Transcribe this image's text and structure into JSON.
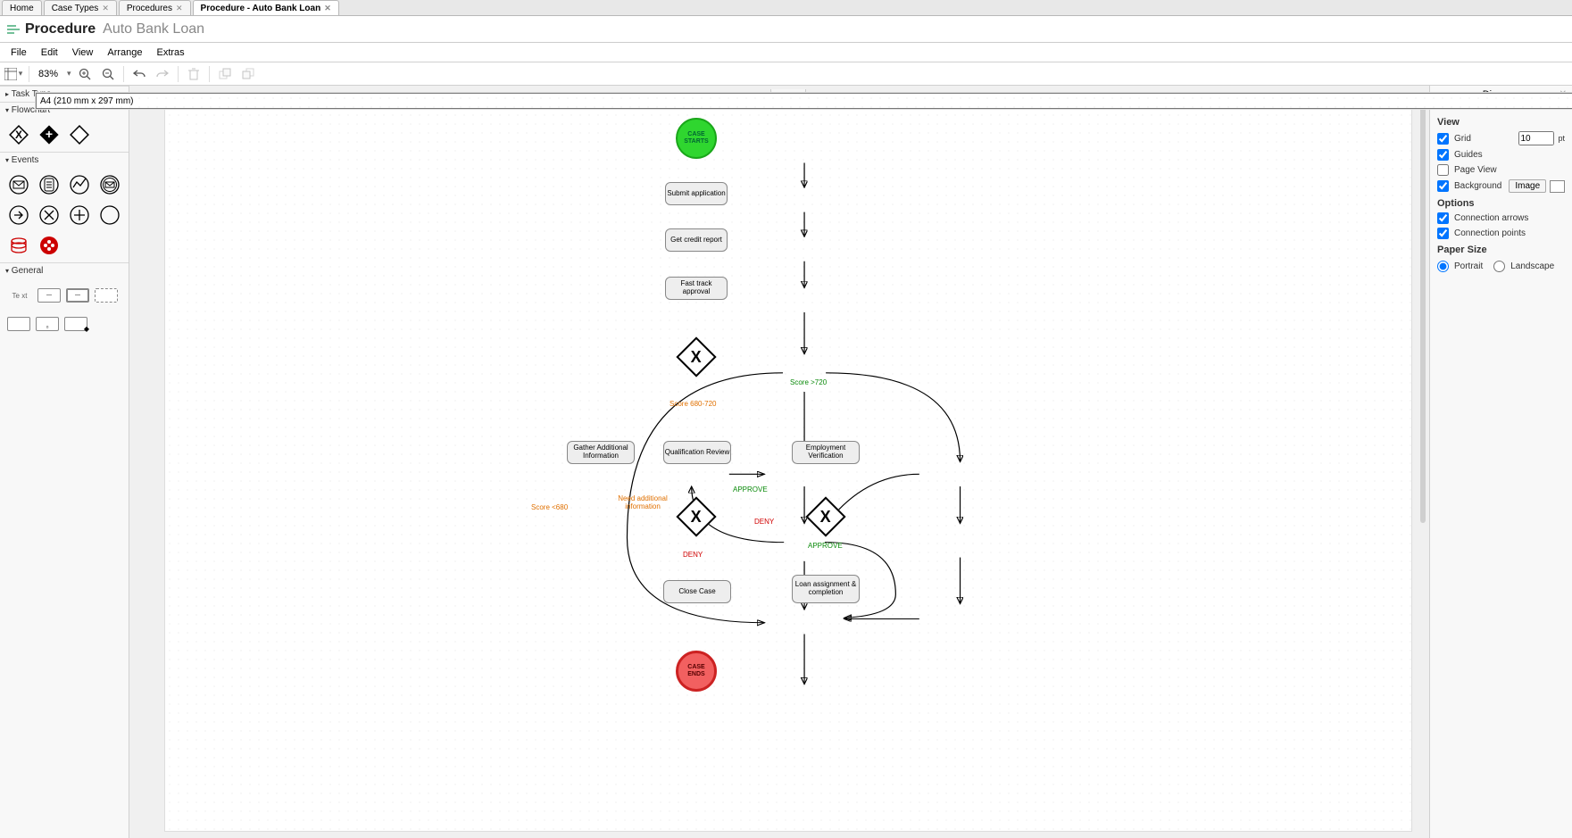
{
  "tabs": [
    {
      "label": "Home",
      "closable": false,
      "active": false
    },
    {
      "label": "Case Types",
      "closable": true,
      "active": false
    },
    {
      "label": "Procedures",
      "closable": true,
      "active": false
    },
    {
      "label": "Procedure - Auto Bank Loan",
      "closable": true,
      "active": true
    }
  ],
  "title": {
    "kind": "Procedure",
    "name": "Auto Bank Loan"
  },
  "menu": [
    "File",
    "Edit",
    "View",
    "Arrange",
    "Extras"
  ],
  "toolbar": {
    "zoom": "83%"
  },
  "left_panel": {
    "sections": {
      "task": {
        "title": "Task Type"
      },
      "flowchart": {
        "title": "Flowchart"
      },
      "events": {
        "title": "Events"
      },
      "general": {
        "title": "General",
        "text_label": "Te xt"
      }
    }
  },
  "right_panel": {
    "title": "Diagram",
    "view_title": "View",
    "grid_label": "Grid",
    "grid_size": "10",
    "grid_unit": "pt",
    "guides_label": "Guides",
    "pageview_label": "Page View",
    "background_label": "Background",
    "image_btn": "Image",
    "options_title": "Options",
    "conn_arrows": "Connection arrows",
    "conn_points": "Connection points",
    "paper_title": "Paper Size",
    "paper_value": "A4 (210 mm x 297 mm)",
    "portrait": "Portrait",
    "landscape": "Landscape"
  },
  "diagram": {
    "nodes": {
      "start": "CASE STARTS",
      "submit": "Submit application",
      "credit": "Get credit report",
      "fast": "Fast track approval",
      "gather": "Gather Additional Information",
      "qual": "Qualification Review",
      "emp": "Employment Verification",
      "close": "Close Case",
      "loan": "Loan assignment & completion",
      "end": "CASE ENDS"
    },
    "labels": {
      "s680_720": "Score 680-720",
      "s_gt720": "Score >720",
      "s_lt680": "Score <680",
      "need_info": "Need additional information",
      "approve1": "APPROVE",
      "approve2": "APPROVE",
      "deny1": "DENY",
      "deny2": "DENY"
    }
  }
}
